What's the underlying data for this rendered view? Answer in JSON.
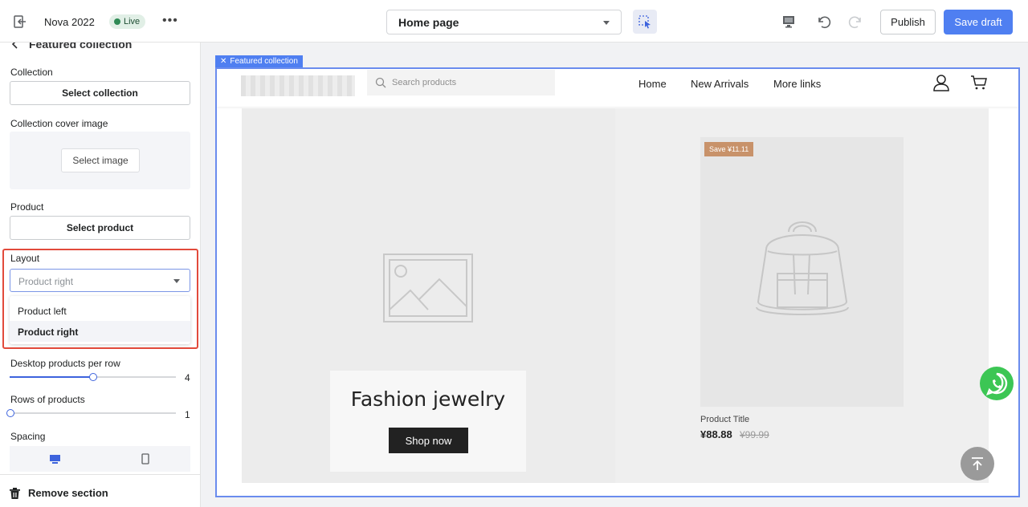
{
  "app": {
    "title": "Nova 2022",
    "live_label": "Live",
    "more_icon": "more-horizontal-icon",
    "page_select": "Home page",
    "publish_label": "Publish",
    "save_draft_label": "Save draft",
    "accent_color": "#4f7ff1"
  },
  "sidebar": {
    "back_title": "Featured collection",
    "collection_label": "Collection",
    "select_collection": "Select collection",
    "cover_label": "Collection cover image",
    "select_image": "Select image",
    "product_label": "Product",
    "select_product": "Select product",
    "layout_label": "Layout",
    "layout_value": "Product right",
    "layout_options": [
      "Product left",
      "Product right"
    ],
    "desktop_per_row_label": "Desktop products per row",
    "desktop_per_row_value": "4",
    "desktop_per_row_fraction": 0.5,
    "rows_label": "Rows of products",
    "rows_value": "1",
    "rows_fraction": 0,
    "spacing_label": "Spacing",
    "remove_section": "Remove section",
    "highlight_color": "#e24a3b"
  },
  "preview": {
    "section_tag": "Featured collection",
    "search_placeholder": "Search products",
    "nav": [
      "Home",
      "New Arrivals",
      "More links"
    ],
    "card_title": "Fashion jewelry",
    "shop_now": "Shop now",
    "save_badge": "Save ¥11.11",
    "product_title": "Product Title",
    "price": "¥88.88",
    "compare_price": "¥99.99"
  }
}
